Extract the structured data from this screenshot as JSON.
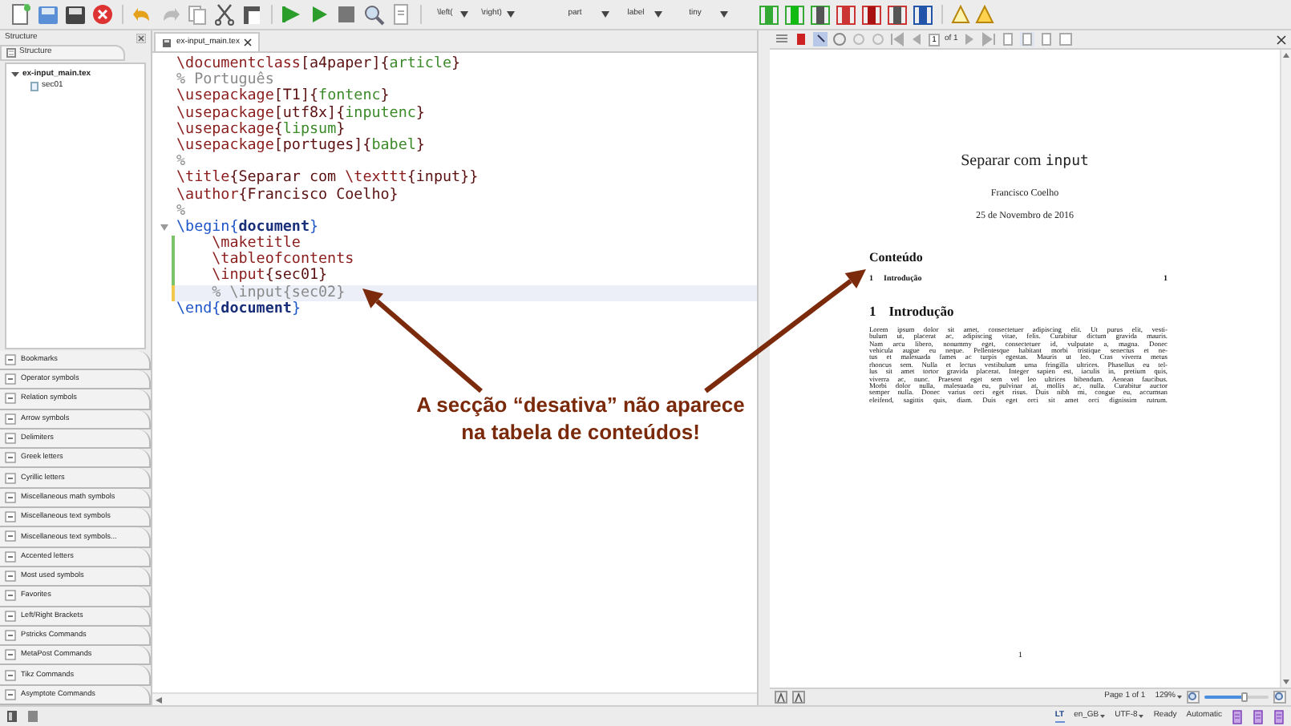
{
  "toolbar": {
    "dropdowns": [
      "\\left(",
      "\\right)",
      "part",
      "label",
      "tiny"
    ]
  },
  "structure_panel": {
    "title": "Structure",
    "tab": "Structure",
    "tree": [
      {
        "label": "ex-input_main.tex",
        "expanded": true,
        "children": [
          {
            "label": "sec01"
          }
        ]
      }
    ]
  },
  "symbol_panels": [
    "Bookmarks",
    "Operator symbols",
    "Relation symbols",
    "Arrow symbols",
    "Delimiters",
    "Greek letters",
    "Cyrillic letters",
    "Miscellaneous math symbols",
    "Miscellaneous text symbols",
    "Miscellaneous text symbols...",
    "Accented letters",
    "Most used symbols",
    "Favorites",
    "Left/Right Brackets",
    "Pstricks Commands",
    "MetaPost Commands",
    "Tikz Commands",
    "Asymptote Commands"
  ],
  "editor": {
    "tab": "ex-input_main.tex",
    "lines": [
      {
        "tokens": [
          {
            "kind": "cmd",
            "text": "\\documentclass"
          },
          {
            "kind": "plain",
            "text": "[a4paper]{"
          },
          {
            "kind": "arg",
            "text": "article"
          },
          {
            "kind": "plain",
            "text": "}"
          }
        ],
        "current": false,
        "foldable": false
      },
      {
        "tokens": [
          {
            "kind": "comment",
            "text": "% Português"
          }
        ],
        "current": false,
        "foldable": false
      },
      {
        "tokens": [
          {
            "kind": "cmd",
            "text": "\\usepackage"
          },
          {
            "kind": "plain",
            "text": "[T1]{"
          },
          {
            "kind": "arg",
            "text": "fontenc"
          },
          {
            "kind": "plain",
            "text": "}"
          }
        ],
        "current": false,
        "foldable": false
      },
      {
        "tokens": [
          {
            "kind": "cmd",
            "text": "\\usepackage"
          },
          {
            "kind": "plain",
            "text": "[utf8x]{"
          },
          {
            "kind": "arg",
            "text": "inputenc"
          },
          {
            "kind": "plain",
            "text": "}"
          }
        ],
        "current": false,
        "foldable": false
      },
      {
        "tokens": [
          {
            "kind": "cmd",
            "text": "\\usepackage"
          },
          {
            "kind": "plain",
            "text": "{"
          },
          {
            "kind": "arg",
            "text": "lipsum"
          },
          {
            "kind": "plain",
            "text": "}"
          }
        ],
        "current": false,
        "foldable": false
      },
      {
        "tokens": [
          {
            "kind": "cmd",
            "text": "\\usepackage"
          },
          {
            "kind": "plain",
            "text": "[portuges]{"
          },
          {
            "kind": "arg",
            "text": "babel"
          },
          {
            "kind": "plain",
            "text": "}"
          }
        ],
        "current": false,
        "foldable": false
      },
      {
        "tokens": [
          {
            "kind": "comment",
            "text": "%"
          }
        ],
        "current": false,
        "foldable": false
      },
      {
        "tokens": [
          {
            "kind": "cmd",
            "text": "\\title"
          },
          {
            "kind": "plain",
            "text": "{Separar com "
          },
          {
            "kind": "cmd",
            "text": "\\texttt"
          },
          {
            "kind": "plain",
            "text": "{input}}"
          }
        ],
        "current": false,
        "foldable": false
      },
      {
        "tokens": [
          {
            "kind": "cmd",
            "text": "\\author"
          },
          {
            "kind": "plain",
            "text": "{Francisco Coelho}"
          }
        ],
        "current": false,
        "foldable": false
      },
      {
        "tokens": [
          {
            "kind": "comment",
            "text": "%"
          }
        ],
        "current": false,
        "foldable": false
      },
      {
        "tokens": [
          {
            "kind": "env",
            "text": "\\begin{"
          },
          {
            "kind": "envname",
            "text": "document"
          },
          {
            "kind": "env",
            "text": "}"
          }
        ],
        "current": false,
        "foldable": true
      },
      {
        "tokens": [
          {
            "kind": "cmd",
            "text": "    \\maketitle"
          }
        ],
        "current": false,
        "foldable": false,
        "color": "#7cc36a"
      },
      {
        "tokens": [
          {
            "kind": "cmd",
            "text": "    \\tableofcontents"
          }
        ],
        "current": false,
        "foldable": false,
        "color": "#7cc36a"
      },
      {
        "tokens": [
          {
            "kind": "cmd",
            "text": "    \\input"
          },
          {
            "kind": "plain",
            "text": "{sec01}"
          }
        ],
        "current": false,
        "foldable": false,
        "color": "#7cc36a"
      },
      {
        "tokens": [
          {
            "kind": "comment",
            "text": "    % \\input{sec02}"
          }
        ],
        "current": true,
        "foldable": false,
        "color": "#f2c94c"
      },
      {
        "tokens": [
          {
            "kind": "env",
            "text": "\\end{"
          },
          {
            "kind": "envname",
            "text": "document"
          },
          {
            "kind": "env",
            "text": "}"
          }
        ],
        "current": false,
        "foldable": false
      }
    ]
  },
  "annotation": {
    "lines": [
      "A secção “desativa” não aparece",
      "na tabela de conteúdos!"
    ]
  },
  "pdf_viewer": {
    "page_input": "1",
    "page_total": "of 1",
    "document": {
      "title": "Separar com",
      "title_code": "input",
      "author": "Francisco Coelho",
      "date": "25 de Novembro de 2016",
      "toc_heading": "Conteúdo",
      "toc": [
        {
          "number": "1",
          "title": "Introdução",
          "page": "1"
        }
      ],
      "section_number": "1",
      "section_title": "Introdução",
      "paragraph_lines": [
        "Lorem ipsum dolor sit amet, consectetuer adipiscing elit. Ut purus elit, vesti-",
        "bulum ut, placerat ac, adipiscing vitae, felis. Curabitur dictum gravida mauris.",
        "Nam arcu libero, nonummy eget, consectetuer id, vulputate a, magna. Donec",
        "vehicula augue eu neque. Pellentesque habitant morbi tristique senectus et ne-",
        "tus et malesuada fames ac turpis egestas. Mauris ut leo. Cras viverra metus",
        "rhoncus sem. Nulla et lectus vestibulum urna fringilla ultrices. Phasellus eu tel-",
        "lus sit amet tortor gravida placerat. Integer sapien est, iaculis in, pretium quis,",
        "viverra ac, nunc. Praesent eget sem vel leo ultrices bibendum. Aenean faucibus.",
        "Morbi dolor nulla, malesuada eu, pulvinar at, mollis ac, nulla. Curabitur auctor",
        "semper nulla. Donec varius orci eget risus. Duis nibh mi, congue eu, accumsan",
        "eleifend, sagittis quis, diam. Duis eget orci sit amet orci dignissim rutrum."
      ],
      "page_number": "1"
    },
    "page_status": "Page 1 of 1",
    "zoom": "129%",
    "zoom_slider": {
      "level": 0.62
    }
  },
  "status_bar": {
    "icon_label": "LT",
    "language": "en_GB",
    "encoding": "UTF-8",
    "state": "Ready",
    "mode": "Automatic"
  }
}
